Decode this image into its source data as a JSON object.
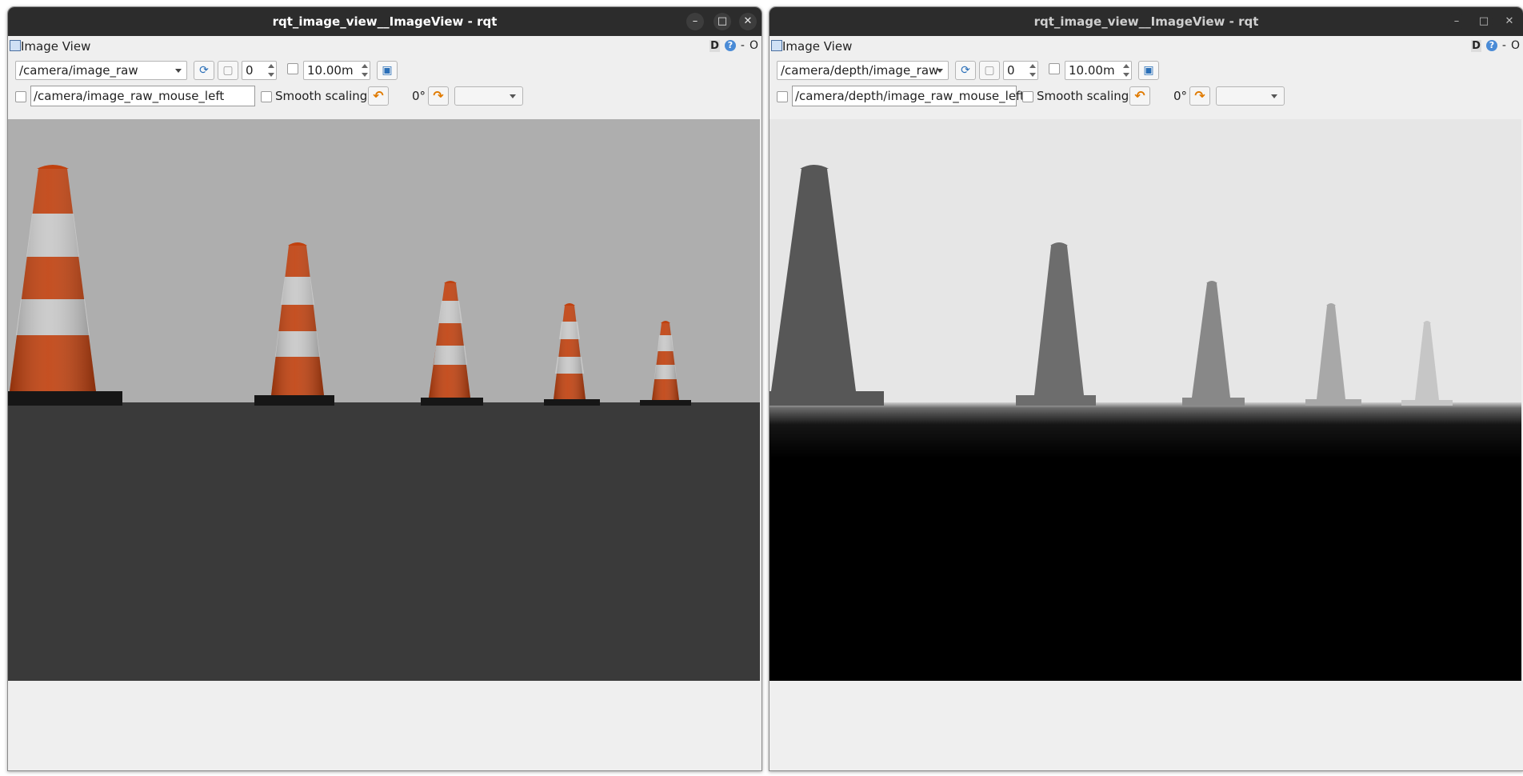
{
  "windows": [
    {
      "title": "rqt_image_view__ImageView - rqt",
      "dock_title": "Image View",
      "dock_controls": {
        "d_label": "D",
        "help": "?",
        "dash": "-",
        "o": "O"
      },
      "topic": "/camera/image_raw",
      "spin_value": "0",
      "max_value": "10.00m",
      "mouse_topic": "/camera/image_raw_mouse_left",
      "smooth_scaling_label": "Smooth scaling",
      "rotation_label": "0°",
      "view_type": "color"
    },
    {
      "title": "rqt_image_view__ImageView - rqt",
      "dock_title": "Image View",
      "dock_controls": {
        "d_label": "D",
        "help": "?",
        "dash": "-",
        "o": "O"
      },
      "topic": "/camera/depth/image_raw",
      "spin_value": "0",
      "max_value": "10.00m",
      "mouse_topic": "/camera/depth/image_raw_mouse_left",
      "smooth_scaling_label": "Smooth scaling",
      "rotation_label": "0°",
      "view_type": "depth"
    }
  ],
  "window_buttons": {
    "minimize": "–",
    "maximize": "□",
    "close": "✕"
  },
  "icons": {
    "refresh": "refresh-icon",
    "pause": "pause-icon",
    "save": "save-icon",
    "rotate_left": "rotate-left-icon",
    "rotate_right": "rotate-right-icon"
  },
  "colors": {
    "titlebar": "#2c2c2c",
    "window_bg": "#efefef",
    "sky_color": "#aeaeae",
    "ground_color": "#3a3a3a",
    "cone_orange": "#c0410f",
    "cone_white": "#c8c8c8",
    "depth_sky": "#e6e6e6",
    "depth_ground": "#000000"
  },
  "scene": {
    "cone_count": 5
  }
}
